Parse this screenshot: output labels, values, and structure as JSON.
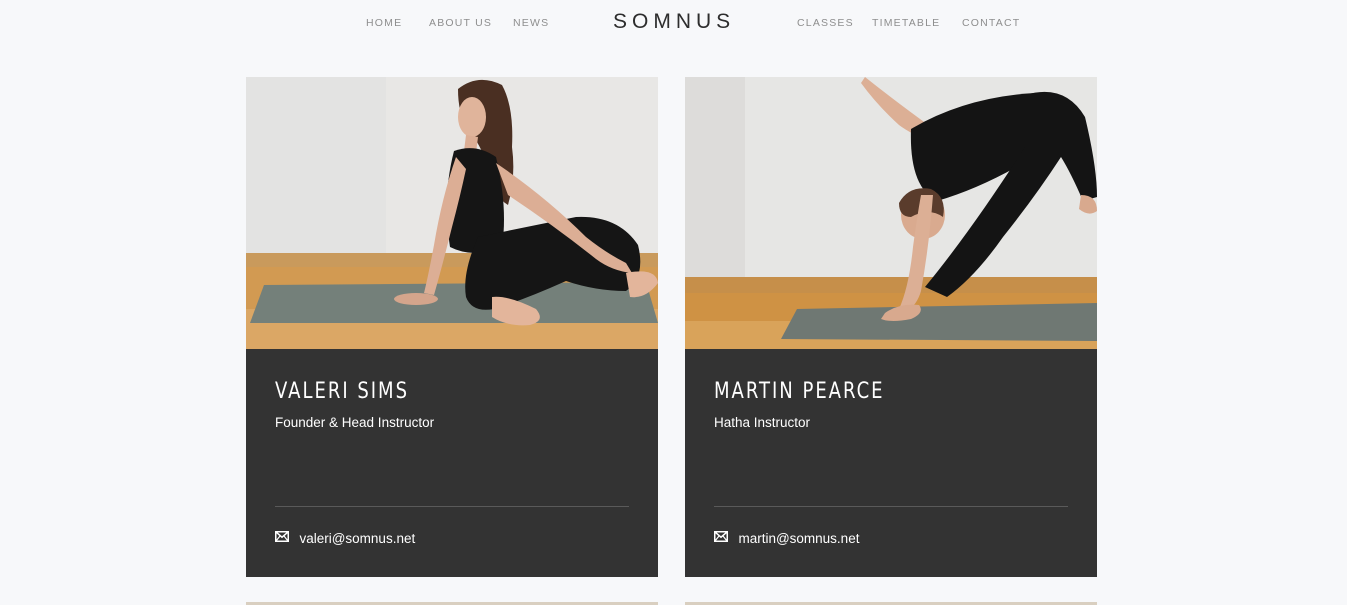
{
  "brand": {
    "logo": "SOMNUS"
  },
  "nav": {
    "left": [
      {
        "label": "HOME"
      },
      {
        "label": "ABOUT US"
      },
      {
        "label": "NEWS"
      }
    ],
    "right": [
      {
        "label": "CLASSES"
      },
      {
        "label": "TIMETABLE"
      },
      {
        "label": "CONTACT"
      }
    ]
  },
  "instructors": [
    {
      "name": "VALERI SIMS",
      "role": "Founder & Head Instructor",
      "email": "valeri@somnus.net",
      "icon": "mail-icon"
    },
    {
      "name": "MARTIN PEARCE",
      "role": "Hatha Instructor",
      "email": "martin@somnus.net",
      "icon": "mail-icon"
    }
  ],
  "colors": {
    "background": "#f7f8fa",
    "card_body": "#333333",
    "nav_text": "#8e8e8e",
    "logo_text": "#2d2d2d"
  }
}
